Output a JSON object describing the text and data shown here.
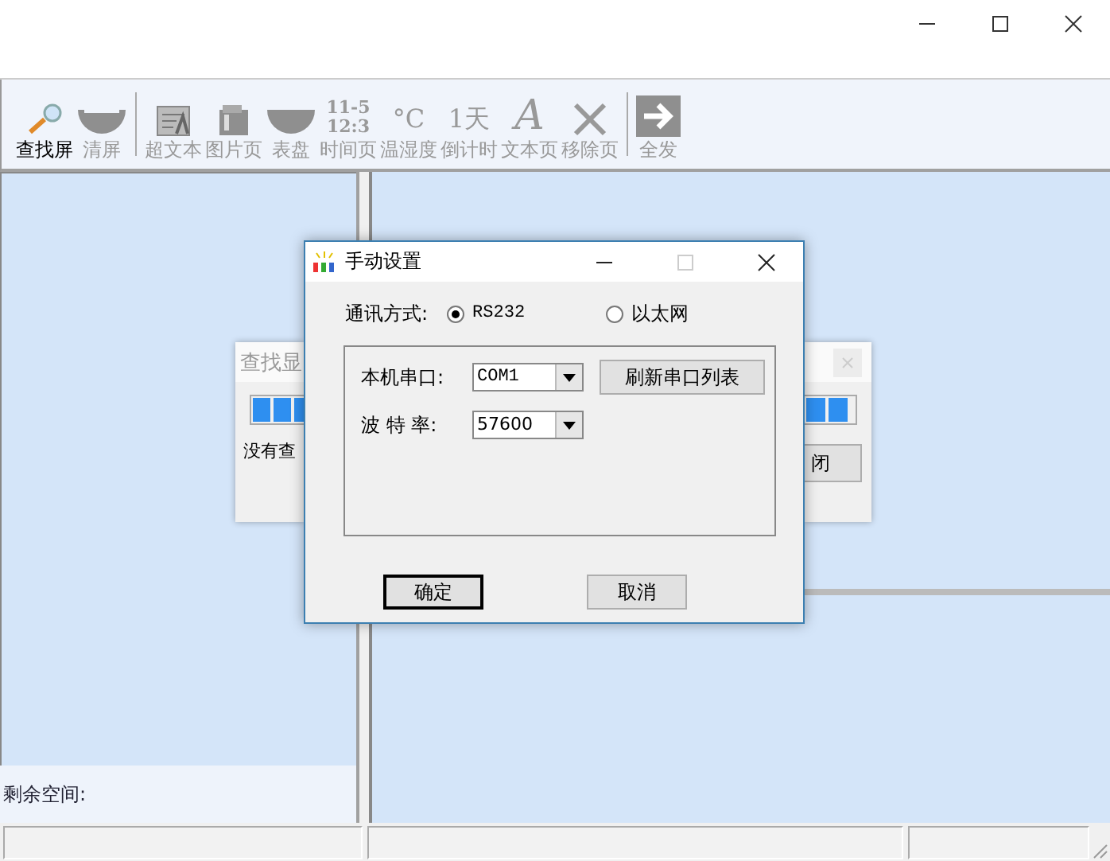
{
  "toolbar": [
    {
      "label": "查找屏",
      "kind": "search",
      "disabled": false
    },
    {
      "label": "清屏",
      "kind": "bowl",
      "disabled": true,
      "separator_after": true
    },
    {
      "label": "超文本",
      "kind": "richtext",
      "disabled": true
    },
    {
      "label": "图片页",
      "kind": "picture",
      "disabled": true
    },
    {
      "label": "表盘",
      "kind": "dial",
      "disabled": true
    },
    {
      "label": "时间页",
      "kind": "time",
      "icon_text": [
        "11-5",
        "12:3"
      ],
      "disabled": true
    },
    {
      "label": "温湿度",
      "kind": "temp",
      "icon_text": [
        "°C"
      ],
      "disabled": true
    },
    {
      "label": "倒计时",
      "kind": "countdown",
      "icon_text": [
        "1天"
      ],
      "disabled": true
    },
    {
      "label": "文本页",
      "kind": "text",
      "icon_text": [
        "A"
      ],
      "disabled": true
    },
    {
      "label": "移除页",
      "kind": "remove",
      "disabled": true,
      "separator_after": true
    },
    {
      "label": "全发",
      "kind": "send",
      "disabled": true
    }
  ],
  "left_panel": {
    "footer": "剩余空间:"
  },
  "background_dialog": {
    "title": "查找显",
    "message": "没有查",
    "button": "闭"
  },
  "dialog": {
    "title": "手动设置",
    "mode_label": "通讯方式:",
    "modes": [
      {
        "label": "RS232",
        "selected": true
      },
      {
        "label": "以太网",
        "selected": false
      }
    ],
    "port_label": "本机串口:",
    "port_value": "COM1",
    "refresh_button": "刷新串口列表",
    "baud_label": "波 特 率:",
    "baud_value": "57600",
    "buttons": [
      {
        "label": "确定",
        "default": true
      },
      {
        "label": "取消",
        "default": false
      }
    ]
  }
}
